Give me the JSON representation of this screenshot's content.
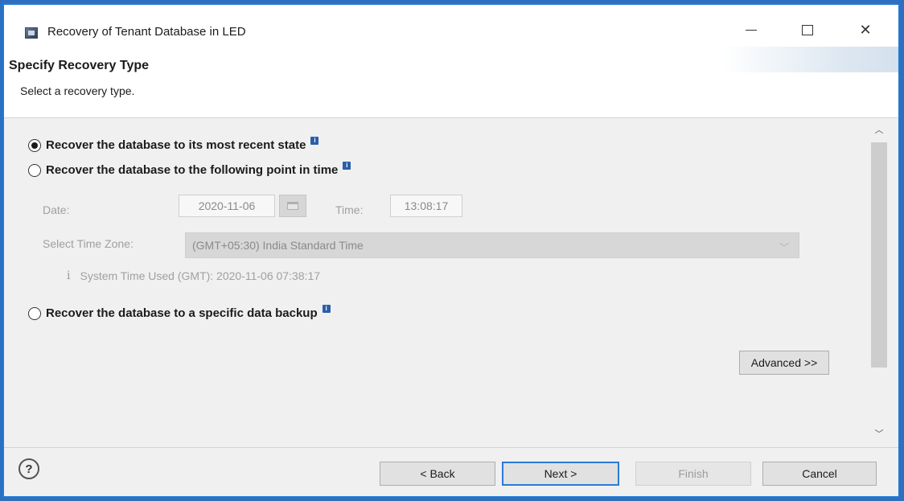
{
  "window": {
    "title": "Recovery of Tenant Database in LED",
    "controls": [
      "minimize",
      "maximize",
      "close"
    ]
  },
  "header": {
    "title": "Specify Recovery Type",
    "subtitle": "Select a recovery type."
  },
  "options": {
    "recent_state": {
      "label": "Recover the database to its most recent state",
      "selected": true
    },
    "point_in_time": {
      "label": "Recover the database to the following point in time",
      "selected": false
    },
    "data_backup": {
      "label": "Recover the database to a specific data backup",
      "selected": false
    }
  },
  "point_in_time": {
    "date_label": "Date:",
    "date_value": "2020-11-06",
    "time_label": "Time:",
    "time_value": "13:08:17",
    "timezone_label": "Select Time Zone:",
    "timezone_value": "(GMT+05:30) India Standard Time",
    "system_time": "System Time Used (GMT): 2020-11-06 07:38:17"
  },
  "buttons": {
    "advanced": "Advanced >>",
    "back": "< Back",
    "next": "Next >",
    "finish": "Finish",
    "cancel": "Cancel",
    "help": "?"
  },
  "icons": {
    "app": "app-window-icon",
    "info_badge": "info-badge-icon",
    "info": "info-icon",
    "calendar": "calendar-icon",
    "help": "help-icon"
  },
  "colors": {
    "accent_border": "#1f7ad6",
    "dialog_bg": "#f0f0f0",
    "info_badge": "#2a5ea8"
  }
}
